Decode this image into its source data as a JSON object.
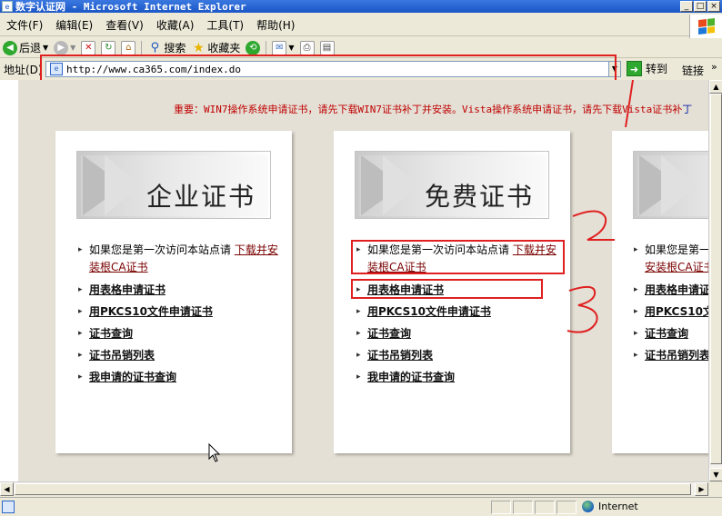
{
  "window": {
    "title": "数字认证网 - Microsoft Internet Explorer",
    "controls": [
      "_",
      "□",
      "×"
    ]
  },
  "menu": [
    "文件(F)",
    "编辑(E)",
    "查看(V)",
    "收藏(A)",
    "工具(T)",
    "帮助(H)"
  ],
  "toolbar": {
    "back": "后退",
    "search": "搜索",
    "favorites": "收藏夹"
  },
  "address": {
    "label": "地址(D)",
    "url": "http://www.ca365.com/index.do",
    "go": "转到",
    "links": "链接"
  },
  "notice": {
    "red": "重要：WIN7操作系统申请证书，请先下载WIN7证书补丁并安装。Vista操作系统申请证书，请先下载Vista证书补",
    "blue": "丁"
  },
  "cards": [
    {
      "title": "企业证书",
      "intro": "如果您是第一次访问本站点请",
      "intro_link": "下载并安装根CA证书",
      "links": [
        "用表格申请证书",
        "用PKCS10文件申请证书",
        "证书查询",
        "证书吊销列表",
        "我申请的证书查询"
      ]
    },
    {
      "title": "免费证书",
      "intro": "如果您是第一次访问本站点请",
      "intro_link": "下载并安装根CA证书",
      "links": [
        "用表格申请证书",
        "用PKCS10文件申请证书",
        "证书查询",
        "证书吊销列表",
        "我申请的证书查询"
      ]
    },
    {
      "title": "",
      "intro": "如果您是第一",
      "intro_link": "安装根CA证书",
      "links": [
        "用表格申请证",
        "用PKCS10文件",
        "证书查询",
        "证书吊销列表"
      ]
    }
  ],
  "status": {
    "zone": "Internet"
  },
  "colors": {
    "notice_red": "#c00000",
    "annotation_red": "#e02020",
    "title_bar": "#1b56c6"
  }
}
